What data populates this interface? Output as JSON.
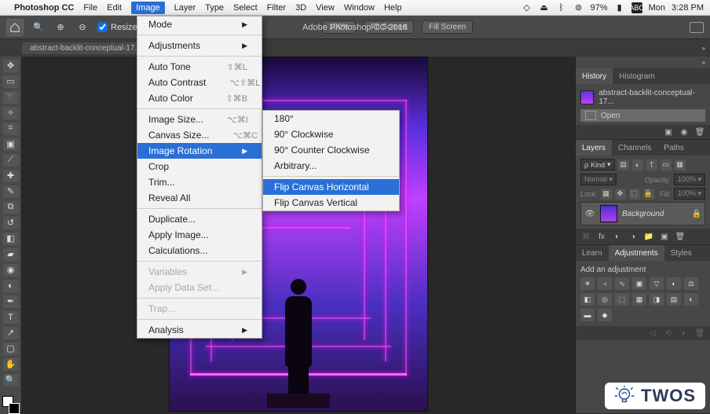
{
  "menubar": {
    "app_name": "Photoshop CC",
    "items": [
      "File",
      "Edit",
      "Image",
      "Layer",
      "Type",
      "Select",
      "Filter",
      "3D",
      "View",
      "Window",
      "Help"
    ],
    "active_index": 2,
    "status": {
      "battery": "97%",
      "keyboard": "ABC",
      "day": "Mon",
      "time": "3:28 PM"
    }
  },
  "app_title": "Adobe Photoshop CC 2018",
  "optbar": {
    "resize_label": "Resize Windows to Fit",
    "zoom_pct": "100%",
    "fit_screen": "Fit Screen",
    "fill_screen": "Fill Screen"
  },
  "tab": {
    "name": "abstract-backlit-conceptual-17..."
  },
  "image_menu": {
    "mode": "Mode",
    "adjustments": "Adjustments",
    "auto_tone": {
      "label": "Auto Tone",
      "sc": "⇧⌘L"
    },
    "auto_contrast": {
      "label": "Auto Contrast",
      "sc": "⌥⇧⌘L"
    },
    "auto_color": {
      "label": "Auto Color",
      "sc": "⇧⌘B"
    },
    "image_size": {
      "label": "Image Size...",
      "sc": "⌥⌘I"
    },
    "canvas_size": {
      "label": "Canvas Size...",
      "sc": "⌥⌘C"
    },
    "rotation": "Image Rotation",
    "crop": "Crop",
    "trim": "Trim...",
    "reveal": "Reveal All",
    "duplicate": "Duplicate...",
    "apply": "Apply Image...",
    "calc": "Calculations...",
    "variables": "Variables",
    "dataset": "Apply Data Set...",
    "trap": "Trap...",
    "analysis": "Analysis"
  },
  "rotation_menu": {
    "r180": "180°",
    "r90cw": "90° Clockwise",
    "r90ccw": "90° Counter Clockwise",
    "arb": "Arbitrary...",
    "fliph": "Flip Canvas Horizontal",
    "flipv": "Flip Canvas Vertical"
  },
  "history_panel": {
    "tab1": "History",
    "tab2": "Histogram",
    "filename": "abstract-backlit-conceptual-17...",
    "open": "Open"
  },
  "layers_panel": {
    "tab1": "Layers",
    "tab2": "Channels",
    "tab3": "Paths",
    "kind": "Kind",
    "blend": "Normal",
    "opacity_lbl": "Opacity:",
    "opacity": "100%",
    "lock_lbl": "Lock:",
    "fill_lbl": "Fill:",
    "fill": "100%",
    "layer_name": "Background"
  },
  "adjustments_panel": {
    "tab1": "Learn",
    "tab2": "Adjustments",
    "tab3": "Styles",
    "title": "Add an adjustment"
  },
  "watermark": {
    "text": "TWOS"
  }
}
